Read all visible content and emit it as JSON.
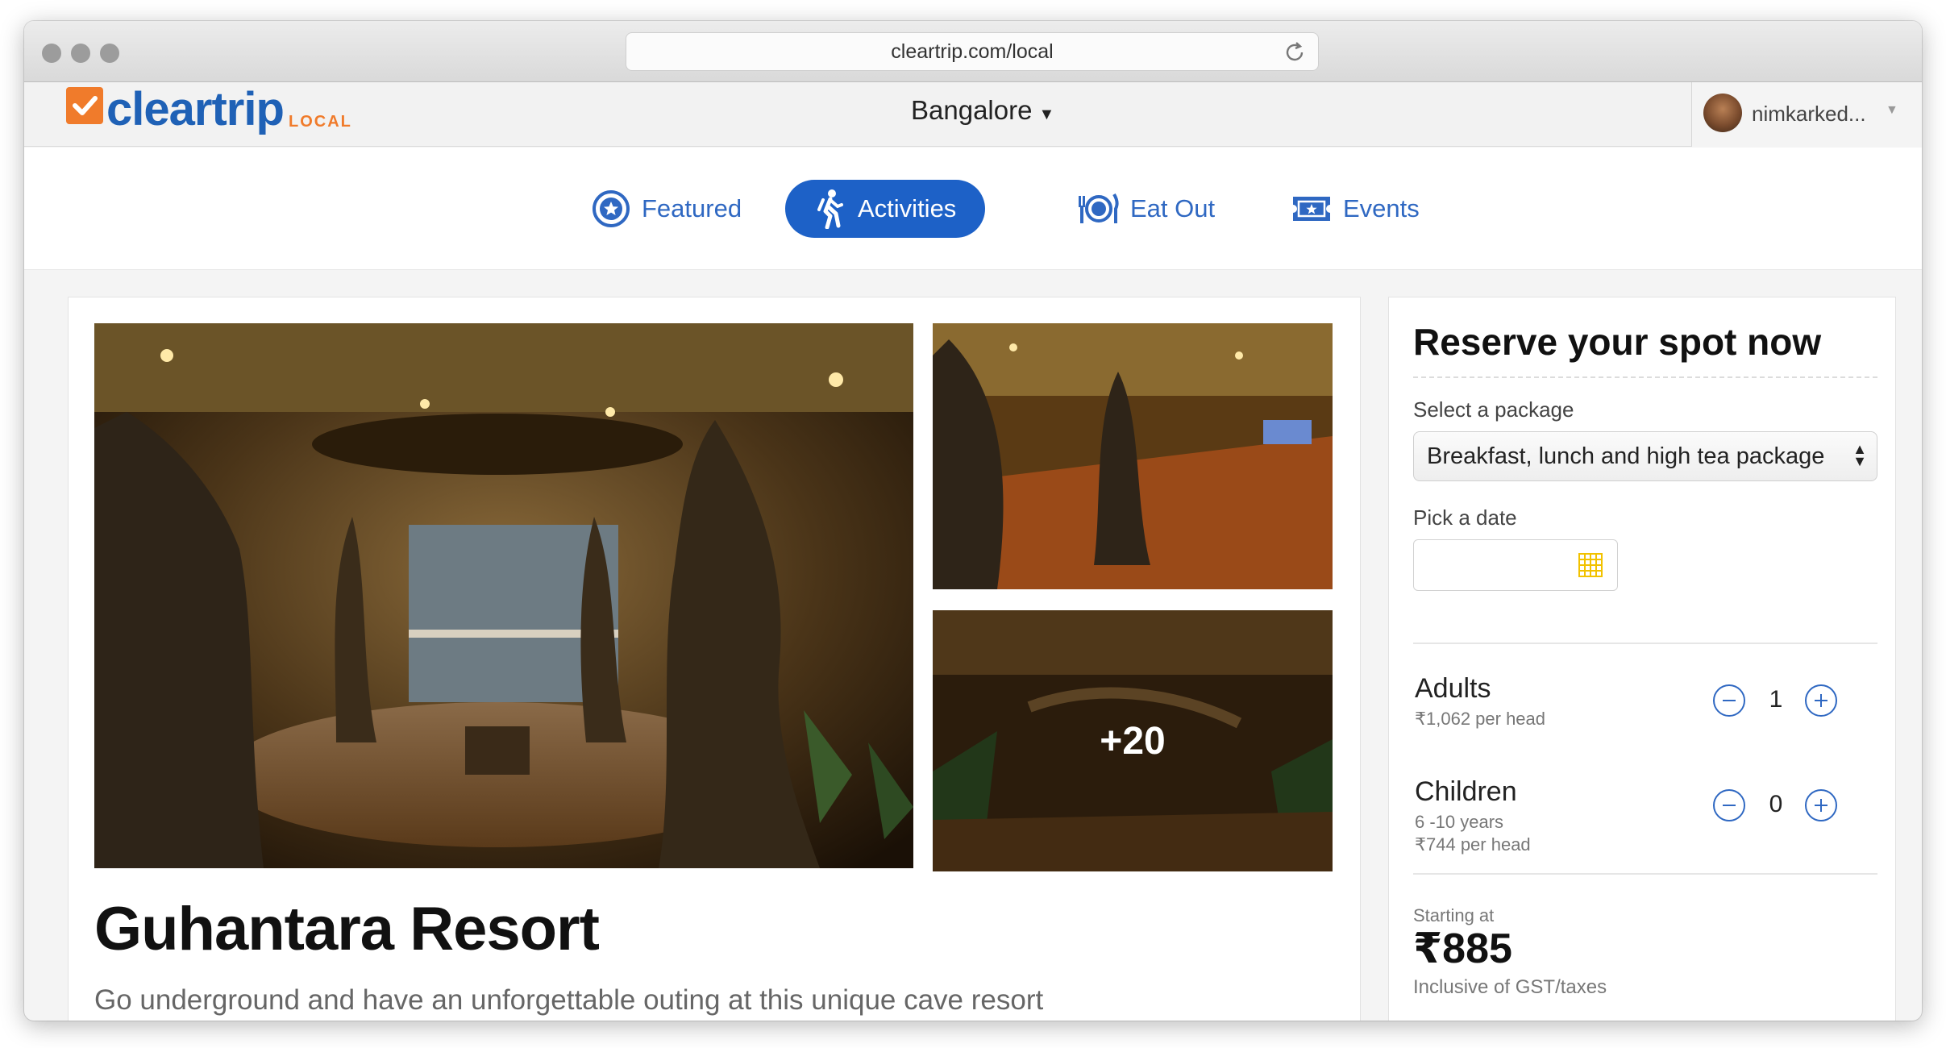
{
  "browser": {
    "url": "cleartrip.com/local"
  },
  "header": {
    "logo_text": "cleartrip",
    "logo_suffix": "LOCAL",
    "city": "Bangalore",
    "user_name": "nimkarked..."
  },
  "nav": {
    "tabs": [
      {
        "label": "Featured",
        "icon": "star-badge-icon",
        "active": false
      },
      {
        "label": "Activities",
        "icon": "hiker-icon",
        "active": true
      },
      {
        "label": "Eat Out",
        "icon": "plate-cutlery-icon",
        "active": false
      },
      {
        "label": "Events",
        "icon": "ticket-icon",
        "active": false
      }
    ]
  },
  "listing": {
    "title": "Guhantara Resort",
    "subtitle": "Go underground and have an unforgettable outing at this unique cave resort",
    "more_photos_label": "+20"
  },
  "reserve": {
    "title": "Reserve your spot now",
    "package_label": "Select a package",
    "package_selected": "Breakfast, lunch and high tea package",
    "date_label": "Pick a date",
    "date_value": "",
    "adults": {
      "title": "Adults",
      "price_note": "₹1,062 per head",
      "count": "1"
    },
    "children": {
      "title": "Children",
      "age_note": "6 -10 years",
      "price_note": "₹744 per head",
      "count": "0"
    },
    "starting_label": "Starting at",
    "price": "₹885",
    "tax_note": "Inclusive of GST/taxes"
  },
  "colors": {
    "brand_blue": "#1d61c7",
    "brand_orange": "#f07b2b",
    "link_blue": "#2f68c2"
  }
}
